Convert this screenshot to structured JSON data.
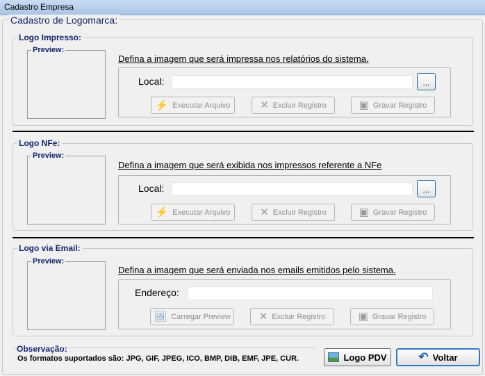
{
  "window": {
    "title": "Cadastro Empresa"
  },
  "main": {
    "title": "Cadastro de Logomarca:"
  },
  "sections": [
    {
      "group_title": "Logo Impresso:",
      "preview_label": "Preview:",
      "heading": "Defina a imagem que será impressa nos relatórios do sistema.",
      "field_label": "Local:",
      "field_value": "",
      "ellipsis": "...",
      "buttons": [
        "Executar Arquivo",
        "Excluir Registro",
        "Gravar Registro"
      ]
    },
    {
      "group_title": "Logo NFe:",
      "preview_label": "Preview:",
      "heading": "Defina a imagem que será exibida nos impressos referente a NFe",
      "field_label": "Local:",
      "field_value": "",
      "ellipsis": "...",
      "buttons": [
        "Executar Arquivo",
        "Excluir Registro",
        "Gravar Registro"
      ]
    },
    {
      "group_title": "Logo via Email:",
      "preview_label": "Preview:",
      "heading": "Defina a imagem que será enviada nos emails emitidos pelo sistema.",
      "field_label": "Endereço:",
      "field_value": "",
      "buttons": [
        "Carregar Preview",
        "Excluir Registro",
        "Gravar Registro"
      ]
    }
  ],
  "observacao": {
    "title": "Observação:",
    "text": "Os formatos suportados são: JPG,  GIF, JPEG,  ICO, BMP, DIB, EMF, JPE, CUR."
  },
  "footer": {
    "logo_pdv_label": "Logo PDV",
    "voltar_label": "Voltar"
  },
  "icons": {
    "execute": "lightning-icon",
    "delete": "x-icon",
    "save": "save-icon",
    "load_preview": "image-load-icon",
    "logo_pdv": "picture-icon",
    "voltar": "undo-arrow-icon"
  }
}
